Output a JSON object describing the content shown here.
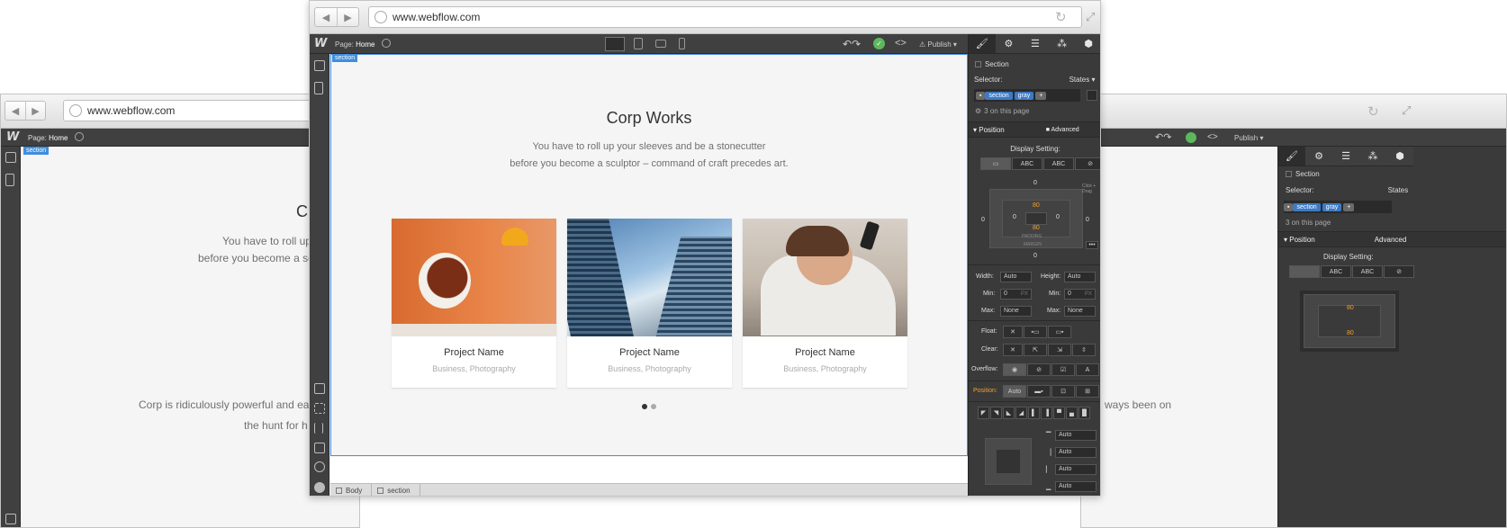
{
  "browser": {
    "url": "www.webflow.com",
    "back_icon": "back-arrow-icon",
    "forward_icon": "forward-arrow-icon"
  },
  "designer": {
    "page_label": "Page:",
    "page_name": "Home",
    "publish_label": "Publish",
    "selection_tag": "section",
    "breadcrumbs": [
      "Body",
      "section"
    ]
  },
  "hero": {
    "title": "Corp Works",
    "subtitle_line1": "You have to roll up your sleeves and be a stonecutter",
    "subtitle_line2": "before you become a sculptor – command of craft precedes art.",
    "left_title_partial": "C",
    "left_sub_line1": "You have to roll up y",
    "left_sub_line2": "before you become a scul",
    "left_body_line1": "Corp is ridiculously powerful and ea",
    "left_body_line2": "the hunt for h",
    "right_body_line1": "ways been on"
  },
  "cards": [
    {
      "name": "Project Name",
      "tags": "Business, Photography",
      "image": "orange-chair-photo"
    },
    {
      "name": "Project Name",
      "tags": "Business, Photography",
      "image": "glass-skyscraper-photo"
    },
    {
      "name": "Project Name",
      "tags": "Business, Photography",
      "image": "woman-with-phone-photo"
    }
  ],
  "panel": {
    "element_name": "Section",
    "selector_label": "Selector:",
    "states_label": "States",
    "class_chips": [
      "section",
      "gray"
    ],
    "add_chip": "+",
    "count_text": "3 on this page",
    "position_header": "Position",
    "advanced_label": "Advanced",
    "display_setting_label": "Display Setting:",
    "display_options": [
      "",
      "ABC",
      "ABC",
      ""
    ],
    "margin_values": {
      "top": "0",
      "left": "0",
      "right": "0",
      "bottom": "0"
    },
    "padding_values": {
      "top": "80",
      "bottom": "80",
      "left": "0",
      "right": "0"
    },
    "click_hint": "Click + Drag",
    "padding_label": "PADDING",
    "margin_label": "MARGIN",
    "width_label": "Width:",
    "width_value": "Auto",
    "height_label": "Height:",
    "height_value": "Auto",
    "min_label": "Min:",
    "min_w": "0",
    "min_h": "0",
    "px_unit": "PX",
    "max_label": "Max:",
    "max_w": "None",
    "max_h": "None",
    "float_label": "Float:",
    "clear_label": "Clear:",
    "overflow_label": "Overflow:",
    "position_label": "Position:",
    "position_value": "Auto",
    "offset_values": [
      "Auto",
      "Auto",
      "Auto",
      "Auto"
    ],
    "accent_orange": "#f0a030",
    "accent_blue": "#3d7ac4",
    "accent_green": "#5cb85c"
  }
}
